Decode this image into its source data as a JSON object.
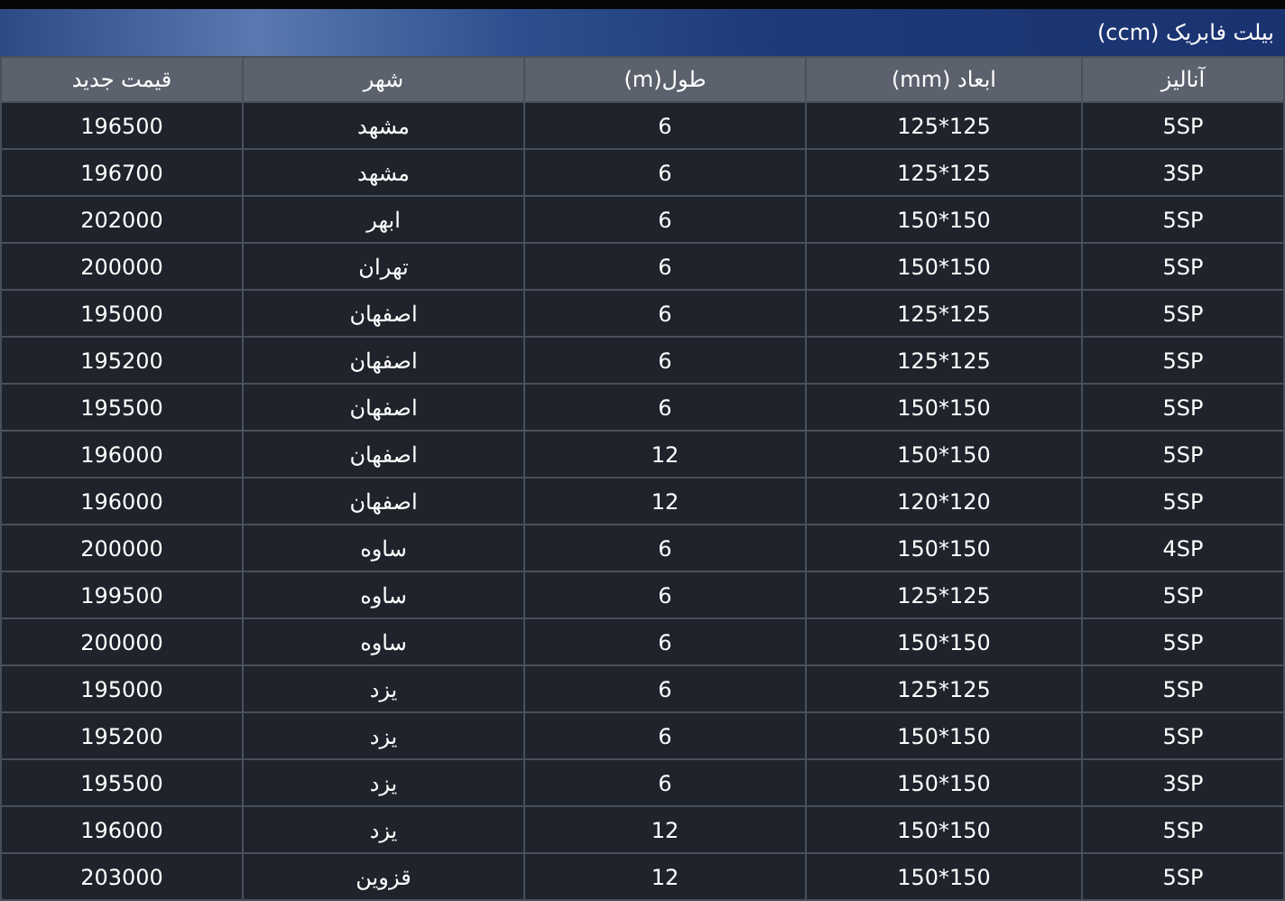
{
  "title": "بیلت فابریک (ccm)",
  "table": {
    "columns": [
      "آنالیز",
      "ابعاد (mm)",
      "طول(m)",
      "شهر",
      "قیمت جدید"
    ],
    "rows": [
      [
        "5SP",
        "125*125",
        "6",
        "مشهد",
        "196500"
      ],
      [
        "3SP",
        "125*125",
        "6",
        "مشهد",
        "196700"
      ],
      [
        "5SP",
        "150*150",
        "6",
        "ابهر",
        "202000"
      ],
      [
        "5SP",
        "150*150",
        "6",
        "تهران",
        "200000"
      ],
      [
        "5SP",
        "125*125",
        "6",
        "اصفهان",
        "195000"
      ],
      [
        "5SP",
        "125*125",
        "6",
        "اصفهان",
        "195200"
      ],
      [
        "5SP",
        "150*150",
        "6",
        "اصفهان",
        "195500"
      ],
      [
        "5SP",
        "150*150",
        "12",
        "اصفهان",
        "196000"
      ],
      [
        "5SP",
        "120*120",
        "12",
        "اصفهان",
        "196000"
      ],
      [
        "4SP",
        "150*150",
        "6",
        "ساوه",
        "200000"
      ],
      [
        "5SP",
        "125*125",
        "6",
        "ساوه",
        "199500"
      ],
      [
        "5SP",
        "150*150",
        "6",
        "ساوه",
        "200000"
      ],
      [
        "5SP",
        "125*125",
        "6",
        "یزد",
        "195000"
      ],
      [
        "5SP",
        "150*150",
        "6",
        "یزد",
        "195200"
      ],
      [
        "3SP",
        "150*150",
        "6",
        "یزد",
        "195500"
      ],
      [
        "5SP",
        "150*150",
        "12",
        "یزد",
        "196000"
      ],
      [
        "5SP",
        "150*150",
        "12",
        "قزوین",
        "203000"
      ]
    ]
  }
}
